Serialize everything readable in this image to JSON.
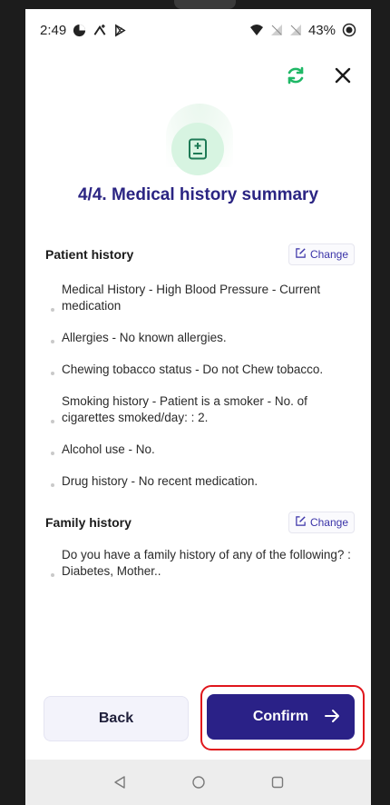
{
  "status_bar": {
    "time": "2:49",
    "battery": "43%",
    "icons_left": [
      "data-saver-icon",
      "network-activity-icon",
      "play-store-icon"
    ],
    "icons_right": [
      "wifi-icon",
      "signal-icon",
      "signal-icon",
      "battery-icon"
    ]
  },
  "header": {
    "refresh_icon": "refresh-icon",
    "close_icon": "close-icon",
    "step_icon": "medical-card-icon",
    "title": "4/4. Medical history summary"
  },
  "patient_history": {
    "title": "Patient history",
    "change_label": "Change",
    "items": [
      "Medical History - High Blood Pressure - Current medication",
      "Allergies - No known allergies.",
      "Chewing tobacco status - Do not Chew tobacco.",
      "Smoking history - Patient is a smoker - No. of cigarettes smoked/day: : 2.",
      "Alcohol use - No.",
      "Drug history - No recent medication."
    ]
  },
  "family_history": {
    "title": "Family history",
    "change_label": "Change",
    "items": [
      "Do you have a family history of any of the following? :  Diabetes, Mother.."
    ]
  },
  "actions": {
    "back_label": "Back",
    "confirm_label": "Confirm"
  },
  "colors": {
    "primary": "#2a2187",
    "accent_green": "#1fb866",
    "highlight_red": "#e0161c"
  }
}
